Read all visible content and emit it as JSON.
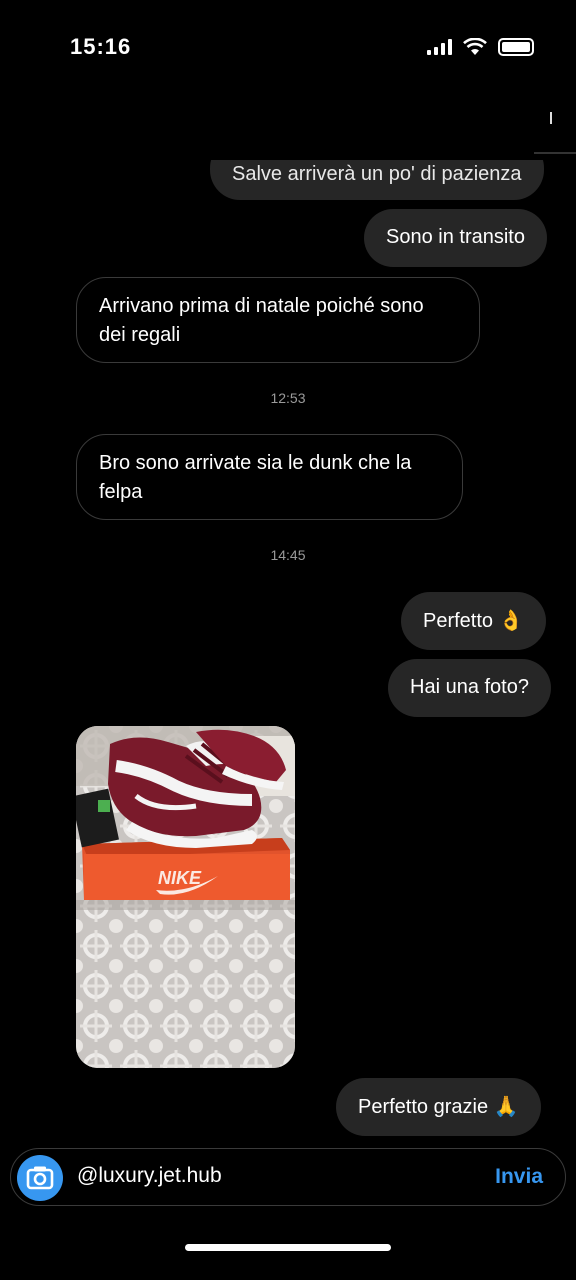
{
  "status_bar": {
    "time": "15:16"
  },
  "messages": [
    {
      "id": "m1",
      "direction": "outgoing",
      "text": "Salve arriverà un po' di pazienza",
      "emoji": ""
    },
    {
      "id": "m2",
      "direction": "outgoing",
      "text": "Sono in transito",
      "emoji": ""
    },
    {
      "id": "m3",
      "direction": "incoming",
      "text_line1": "Arrivano prima di natale poiché sono",
      "text_line2": "dei regali"
    },
    {
      "id": "t1",
      "type": "timestamp",
      "text": "12:53"
    },
    {
      "id": "m4",
      "direction": "incoming",
      "text_line1": "Bro sono arrivate sia le dunk che la",
      "text_line2": "felpa"
    },
    {
      "id": "t2",
      "type": "timestamp",
      "text": "14:45"
    },
    {
      "id": "m5",
      "direction": "outgoing",
      "text": "Perfetto",
      "emoji": "👌"
    },
    {
      "id": "m6",
      "direction": "outgoing",
      "text": "Hai una foto?",
      "emoji": ""
    },
    {
      "id": "m7",
      "direction": "incoming",
      "type": "photo",
      "box_label": "NIKE"
    },
    {
      "id": "m8",
      "direction": "outgoing",
      "text": "Perfetto grazie",
      "emoji": "🙏"
    }
  ],
  "composer": {
    "text": "@luxury.jet.hub",
    "send_label": "Invia",
    "camera_icon": "camera-icon",
    "accent_color": "#3797f0"
  }
}
